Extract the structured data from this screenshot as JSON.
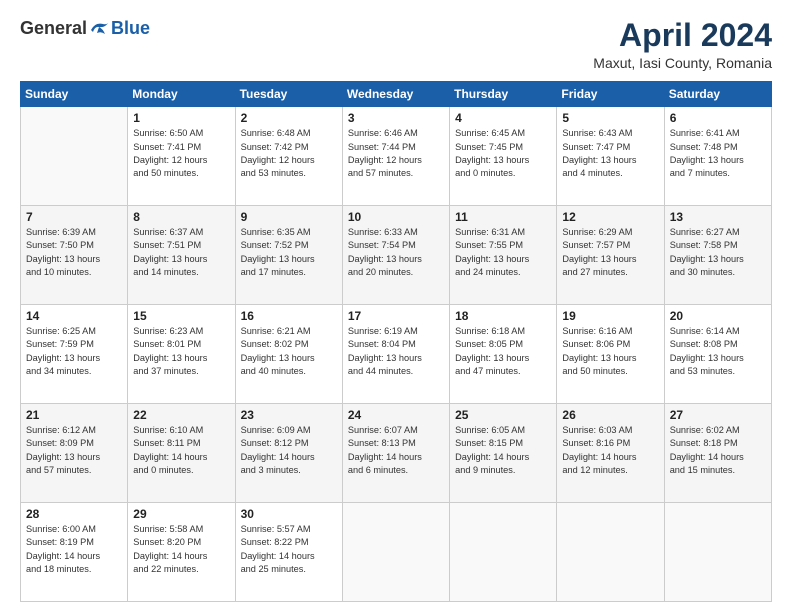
{
  "header": {
    "logo_general": "General",
    "logo_blue": "Blue",
    "month_title": "April 2024",
    "location": "Maxut, Iasi County, Romania"
  },
  "days_of_week": [
    "Sunday",
    "Monday",
    "Tuesday",
    "Wednesday",
    "Thursday",
    "Friday",
    "Saturday"
  ],
  "weeks": [
    [
      {
        "num": "",
        "info": ""
      },
      {
        "num": "1",
        "info": "Sunrise: 6:50 AM\nSunset: 7:41 PM\nDaylight: 12 hours\nand 50 minutes."
      },
      {
        "num": "2",
        "info": "Sunrise: 6:48 AM\nSunset: 7:42 PM\nDaylight: 12 hours\nand 53 minutes."
      },
      {
        "num": "3",
        "info": "Sunrise: 6:46 AM\nSunset: 7:44 PM\nDaylight: 12 hours\nand 57 minutes."
      },
      {
        "num": "4",
        "info": "Sunrise: 6:45 AM\nSunset: 7:45 PM\nDaylight: 13 hours\nand 0 minutes."
      },
      {
        "num": "5",
        "info": "Sunrise: 6:43 AM\nSunset: 7:47 PM\nDaylight: 13 hours\nand 4 minutes."
      },
      {
        "num": "6",
        "info": "Sunrise: 6:41 AM\nSunset: 7:48 PM\nDaylight: 13 hours\nand 7 minutes."
      }
    ],
    [
      {
        "num": "7",
        "info": "Sunrise: 6:39 AM\nSunset: 7:50 PM\nDaylight: 13 hours\nand 10 minutes."
      },
      {
        "num": "8",
        "info": "Sunrise: 6:37 AM\nSunset: 7:51 PM\nDaylight: 13 hours\nand 14 minutes."
      },
      {
        "num": "9",
        "info": "Sunrise: 6:35 AM\nSunset: 7:52 PM\nDaylight: 13 hours\nand 17 minutes."
      },
      {
        "num": "10",
        "info": "Sunrise: 6:33 AM\nSunset: 7:54 PM\nDaylight: 13 hours\nand 20 minutes."
      },
      {
        "num": "11",
        "info": "Sunrise: 6:31 AM\nSunset: 7:55 PM\nDaylight: 13 hours\nand 24 minutes."
      },
      {
        "num": "12",
        "info": "Sunrise: 6:29 AM\nSunset: 7:57 PM\nDaylight: 13 hours\nand 27 minutes."
      },
      {
        "num": "13",
        "info": "Sunrise: 6:27 AM\nSunset: 7:58 PM\nDaylight: 13 hours\nand 30 minutes."
      }
    ],
    [
      {
        "num": "14",
        "info": "Sunrise: 6:25 AM\nSunset: 7:59 PM\nDaylight: 13 hours\nand 34 minutes."
      },
      {
        "num": "15",
        "info": "Sunrise: 6:23 AM\nSunset: 8:01 PM\nDaylight: 13 hours\nand 37 minutes."
      },
      {
        "num": "16",
        "info": "Sunrise: 6:21 AM\nSunset: 8:02 PM\nDaylight: 13 hours\nand 40 minutes."
      },
      {
        "num": "17",
        "info": "Sunrise: 6:19 AM\nSunset: 8:04 PM\nDaylight: 13 hours\nand 44 minutes."
      },
      {
        "num": "18",
        "info": "Sunrise: 6:18 AM\nSunset: 8:05 PM\nDaylight: 13 hours\nand 47 minutes."
      },
      {
        "num": "19",
        "info": "Sunrise: 6:16 AM\nSunset: 8:06 PM\nDaylight: 13 hours\nand 50 minutes."
      },
      {
        "num": "20",
        "info": "Sunrise: 6:14 AM\nSunset: 8:08 PM\nDaylight: 13 hours\nand 53 minutes."
      }
    ],
    [
      {
        "num": "21",
        "info": "Sunrise: 6:12 AM\nSunset: 8:09 PM\nDaylight: 13 hours\nand 57 minutes."
      },
      {
        "num": "22",
        "info": "Sunrise: 6:10 AM\nSunset: 8:11 PM\nDaylight: 14 hours\nand 0 minutes."
      },
      {
        "num": "23",
        "info": "Sunrise: 6:09 AM\nSunset: 8:12 PM\nDaylight: 14 hours\nand 3 minutes."
      },
      {
        "num": "24",
        "info": "Sunrise: 6:07 AM\nSunset: 8:13 PM\nDaylight: 14 hours\nand 6 minutes."
      },
      {
        "num": "25",
        "info": "Sunrise: 6:05 AM\nSunset: 8:15 PM\nDaylight: 14 hours\nand 9 minutes."
      },
      {
        "num": "26",
        "info": "Sunrise: 6:03 AM\nSunset: 8:16 PM\nDaylight: 14 hours\nand 12 minutes."
      },
      {
        "num": "27",
        "info": "Sunrise: 6:02 AM\nSunset: 8:18 PM\nDaylight: 14 hours\nand 15 minutes."
      }
    ],
    [
      {
        "num": "28",
        "info": "Sunrise: 6:00 AM\nSunset: 8:19 PM\nDaylight: 14 hours\nand 18 minutes."
      },
      {
        "num": "29",
        "info": "Sunrise: 5:58 AM\nSunset: 8:20 PM\nDaylight: 14 hours\nand 22 minutes."
      },
      {
        "num": "30",
        "info": "Sunrise: 5:57 AM\nSunset: 8:22 PM\nDaylight: 14 hours\nand 25 minutes."
      },
      {
        "num": "",
        "info": ""
      },
      {
        "num": "",
        "info": ""
      },
      {
        "num": "",
        "info": ""
      },
      {
        "num": "",
        "info": ""
      }
    ]
  ]
}
